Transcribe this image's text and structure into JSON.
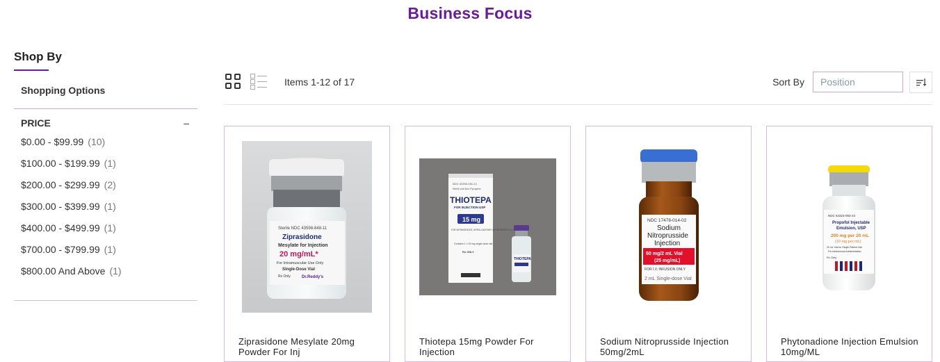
{
  "page": {
    "title": "Business Focus"
  },
  "sidebar": {
    "shop_by": "Shop By",
    "shopping_options": "Shopping Options",
    "price_filter": {
      "title": "PRICE",
      "toggle": "–",
      "items": [
        {
          "label": "$0.00 - $99.99",
          "count": "(10)"
        },
        {
          "label": "$100.00 - $199.99",
          "count": "(1)"
        },
        {
          "label": "$200.00 - $299.99",
          "count": "(2)"
        },
        {
          "label": "$300.00 - $399.99",
          "count": "(1)"
        },
        {
          "label": "$400.00 - $499.99",
          "count": "(1)"
        },
        {
          "label": "$700.00 - $799.99",
          "count": "(1)"
        },
        {
          "label": "$800.00 And Above",
          "count": "(1)"
        }
      ]
    }
  },
  "toolbar": {
    "items_count": "Items 1-12 of 17",
    "sort_label": "Sort By",
    "sort_value": "Position"
  },
  "products": [
    {
      "name": "Ziprasidone Mesylate 20mg Powder For Inj",
      "label_lines": [
        "Sterile NDC 43598-848-11",
        "Ziprasidone",
        "Mesylate for Injection",
        "20 mg/mL*",
        "For Intramuscular Use Only",
        "Single-Dose Vial",
        "Rx Only",
        "Dr.Reddy's"
      ]
    },
    {
      "name": "Thiotepa 15mg Powder For Injection",
      "label_lines": [
        "NDC 63395-030-10",
        "Sterile and Non-Pyrogenic",
        "THIOTEPA",
        "FOR INJECTION USP",
        "15 mg",
        "FOR INTRAVENOUS, INTRA-CAVITARY OR INTRAVESICAL USE",
        "Contains 1 x 15 mg single-dose vial",
        "Rx ONLY",
        "THIOTEPA"
      ]
    },
    {
      "name": "Sodium Nitroprusside Injection 50mg/2mL",
      "label_lines": [
        "NDC 17478-014-02",
        "Sodium",
        "Nitroprusside",
        "Injection",
        "50 mg/2 mL Vial",
        "(25 mg/mL)",
        "FOR I.V. INFUSION ONLY",
        "2 mL Single-dose Vial"
      ]
    },
    {
      "name": "Phytonadione Injection Emulsion 10mg/ML",
      "label_lines": [
        "NDC 63323-093-23",
        "Propofol Injectable",
        "Emulsion, USP",
        "200 mg per 20 mL",
        "(10 mg per mL)",
        "20 mL Vial for Single Patient Use",
        "For Intravenous Administration",
        "Rx Only"
      ]
    }
  ],
  "colors": {
    "accent": "#6a1b9a",
    "card_border": "#d9b8e3",
    "vial_blue": "#3a6fd1",
    "vial_yellow": "#f5d90a",
    "thiotepa_bg": "#7a7777"
  }
}
